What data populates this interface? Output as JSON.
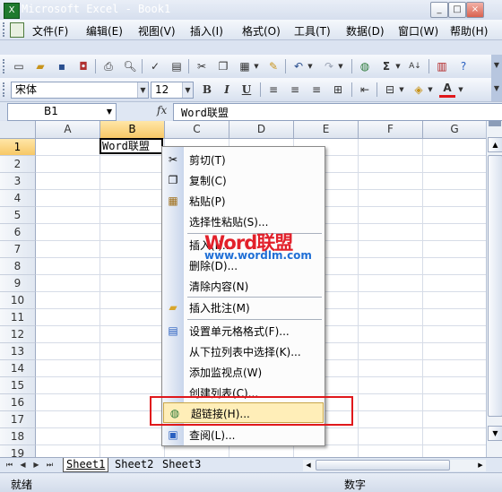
{
  "window": {
    "title": "Microsoft Excel - Book1",
    "controls": [
      "_",
      "□",
      "×"
    ]
  },
  "menubar": {
    "items": [
      "文件(F)",
      "编辑(E)",
      "视图(V)",
      "插入(I)",
      "格式(O)",
      "工具(T)",
      "数据(D)",
      "窗口(W)",
      "帮助(H)"
    ],
    "mdi_controls": [
      "_",
      "♦",
      "×"
    ]
  },
  "toolbar_format": {
    "font_name": "宋体",
    "font_size": "12",
    "bold": "B",
    "italic": "I",
    "underline": "U",
    "font_color_letter": "A"
  },
  "formula_bar": {
    "name_box": "B1",
    "fx": "fx",
    "content": "Word联盟"
  },
  "grid": {
    "columns": [
      "A",
      "B",
      "C",
      "D",
      "E",
      "F",
      "G"
    ],
    "active_column": "B",
    "rows": [
      "1",
      "2",
      "3",
      "4",
      "5",
      "6",
      "7",
      "8",
      "9",
      "10",
      "11",
      "12",
      "13",
      "14",
      "15",
      "16",
      "17",
      "18",
      "19"
    ],
    "active_row": "1",
    "cell_b1": "Word联盟"
  },
  "context_menu": {
    "items": [
      {
        "label": "剪切(T)",
        "icon": "scissors-icon"
      },
      {
        "label": "复制(C)",
        "icon": "copy-icon"
      },
      {
        "label": "粘贴(P)",
        "icon": "paste-icon"
      },
      {
        "label": "选择性粘贴(S)...",
        "icon": ""
      },
      {
        "label": "插入(I)...",
        "icon": ""
      },
      {
        "label": "删除(D)...",
        "icon": ""
      },
      {
        "label": "清除内容(N)",
        "icon": ""
      },
      {
        "label": "插入批注(M)",
        "icon": "comment-icon"
      },
      {
        "label": "设置单元格格式(F)...",
        "icon": "format-cells-icon"
      },
      {
        "label": "从下拉列表中选择(K)...",
        "icon": ""
      },
      {
        "label": "添加监视点(W)",
        "icon": ""
      },
      {
        "label": "创建列表(C)...",
        "icon": ""
      },
      {
        "label": "超链接(H)...",
        "icon": "hyperlink-icon"
      },
      {
        "label": "查阅(L)...",
        "icon": "research-icon"
      }
    ]
  },
  "watermark": {
    "brand": "Word联盟",
    "url": "www.wordlm.com"
  },
  "sheet_tabs": [
    "Sheet1",
    "Sheet2",
    "Sheet3"
  ],
  "active_sheet": "Sheet1",
  "status": {
    "left": "就绪",
    "right": "数字"
  },
  "colors": {
    "highlight_box": "#e0181c",
    "menu_highlight": "#ffeeb8",
    "active_header": "#f7c866"
  }
}
